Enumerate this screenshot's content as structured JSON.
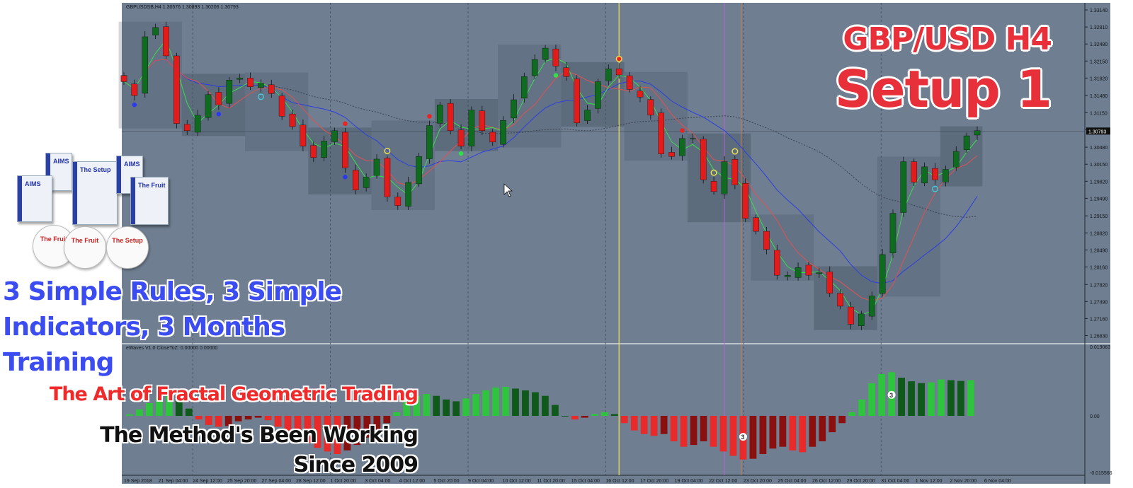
{
  "chart_data": {
    "type": "candlestick",
    "symbol_header": "GBPUSDSB,H4  1.30576 1.30893 1.30206 1.30793",
    "current_price_label": "1.30793",
    "price_axis_labels": [
      "1.33140",
      "1.32810",
      "1.32480",
      "1.32150",
      "1.31820",
      "1.31480",
      "1.31150",
      "1.30820",
      "1.30480",
      "1.30150",
      "1.29820",
      "1.29490",
      "1.29150",
      "1.28820",
      "1.28490",
      "1.28160",
      "1.27820",
      "1.27490",
      "1.27160",
      "1.26830"
    ],
    "price_range": [
      1.267,
      1.3325
    ],
    "time_axis_labels": [
      "19 Sep 2018",
      "21 Sep 04:00",
      "24 Sep 12:00",
      "25 Sep 20:00",
      "27 Sep 04:00",
      "28 Sep 12:00",
      "1 Oct 20:00",
      "3 Oct 04:00",
      "4 Oct 12:00",
      "5 Oct 20:00",
      "9 Oct 04:00",
      "10 Oct 12:00",
      "11 Oct 20:00",
      "15 Oct 04:00",
      "16 Oct 12:00",
      "17 Oct 20:00",
      "19 Oct 04:00",
      "22 Oct 12:00",
      "23 Oct 20:00",
      "25 Oct 04:00",
      "26 Oct 12:00",
      "29 Oct 20:00",
      "31 Oct 04:00",
      "1 Nov 12:00",
      "2 Nov 20:00",
      "6 Nov 04:00"
    ],
    "close_path": [
      1.3175,
      1.3148,
      1.3262,
      1.328,
      1.3225,
      1.3094,
      1.308,
      1.311,
      1.315,
      1.313,
      1.3178,
      1.3182,
      1.3165,
      1.3172,
      1.3152,
      1.3108,
      1.3088,
      1.305,
      1.3028,
      1.306,
      1.308,
      1.3008,
      1.2965,
      1.299,
      1.3025,
      1.2952,
      1.2935,
      1.298,
      1.303,
      1.309,
      1.313,
      1.308,
      1.305,
      1.312,
      1.308,
      1.3058,
      1.31,
      1.314,
      1.3185,
      1.3218,
      1.324,
      1.3205,
      1.3185,
      1.3095,
      1.312,
      1.3175,
      1.32,
      1.3188,
      1.316,
      1.3145,
      1.311,
      1.3035,
      1.303,
      1.3065,
      1.3065,
      1.2985,
      1.2962,
      1.302,
      1.2975,
      1.291,
      1.2885,
      1.285,
      1.28,
      1.28,
      1.2815,
      1.28,
      1.2805,
      1.2765,
      1.274,
      1.2705,
      1.2725,
      1.276,
      1.284,
      1.292,
      1.302,
      1.298,
      1.301,
      1.2985,
      1.3005,
      1.304,
      1.307,
      1.308
    ],
    "indicator": {
      "header": "eWaves V1.0 CloseToZ:  0.00000 0.00000",
      "axis_labels": [
        "0.019063",
        "0.00",
        "-0.015566"
      ],
      "range": [
        -0.015566,
        0.019063
      ],
      "wave_labels": [
        "3",
        "3"
      ],
      "values": [
        0.0004,
        0.0018,
        0.0035,
        0.005,
        0.006,
        0.0045,
        0.002,
        -0.001,
        -0.0025,
        -0.003,
        -0.0028,
        -0.0015,
        -0.001,
        -0.0005,
        -0.0012,
        -0.003,
        -0.0045,
        -0.006,
        -0.0075,
        -0.0088,
        -0.0098,
        -0.0105,
        -0.0095,
        -0.008,
        -0.006,
        -0.004,
        -0.002,
        0.001,
        0.004,
        0.0055,
        0.006,
        0.0055,
        0.0045,
        0.004,
        0.0048,
        0.006,
        0.007,
        0.0078,
        0.008,
        0.0075,
        0.007,
        0.0065,
        0.0055,
        0.003,
        0.0,
        -0.001,
        -0.0005,
        0.0005,
        0.001,
        0.0005,
        -0.002,
        -0.004,
        -0.005,
        -0.0055,
        -0.005,
        -0.007,
        -0.0085,
        -0.008,
        -0.007,
        -0.0085,
        -0.0098,
        -0.011,
        -0.012,
        -0.0118,
        -0.0105,
        -0.009,
        -0.0085,
        -0.0095,
        -0.01,
        -0.0085,
        -0.007,
        -0.0045,
        -0.002,
        0.001,
        0.0045,
        0.009,
        0.0115,
        0.012,
        0.0105,
        0.0095,
        0.009,
        0.0092,
        0.01,
        0.0098,
        0.0096,
        0.0098
      ]
    },
    "colors": {
      "bull": "#0f6b1f",
      "bear": "#e31b1b",
      "green_ma": "#35e04a",
      "red_ma": "#e15151",
      "blue_ma": "#2c3fe0",
      "dotted_ma": "#3b4252",
      "grid": "#3a4556",
      "bg": "#6f7e90"
    }
  },
  "overlay_title": {
    "line1": "GBP/USD H4",
    "line2": "Setup 1"
  },
  "promo": {
    "headline_lines": [
      "3 Simple Rules, 3 Simple",
      "Indicators, 3 Months",
      "Training"
    ],
    "tagline": "The Art of Fractal Geometric Trading",
    "claim_lines": [
      "The Method's Been Working",
      "Since 2009"
    ]
  },
  "product_art": {
    "book_labels": [
      "AIMS",
      "The Setup",
      "The Fruit"
    ],
    "disc_labels": [
      "The Fruit",
      "The Setup"
    ]
  }
}
